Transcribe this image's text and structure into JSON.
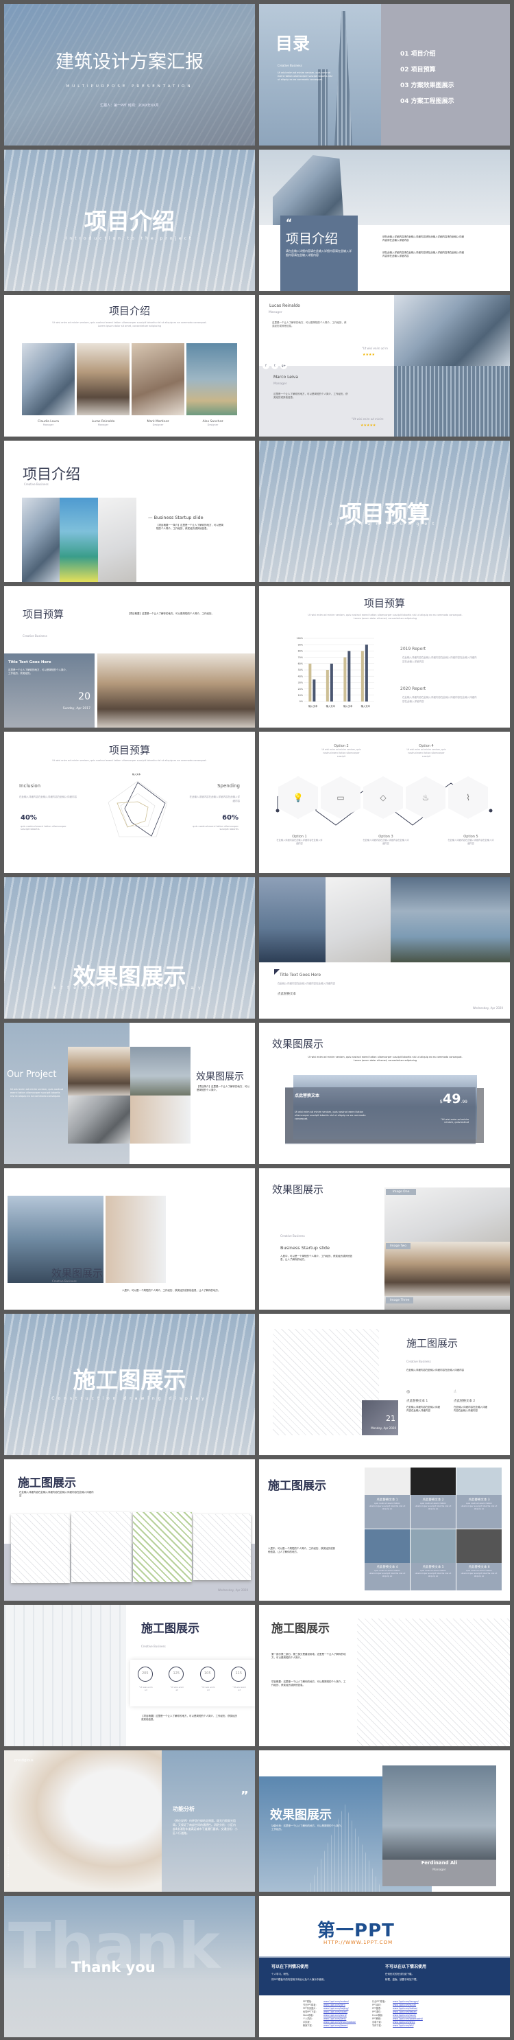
{
  "colors": {
    "background": "#5a5a5a",
    "accent_blue": "#5d7390",
    "navy": "#1e3c6e",
    "tan": "#cdbf95",
    "bar_navy": "#4a5670",
    "logo_orange": "#e07a1f"
  },
  "s1": {
    "title": "建筑设计方案汇报",
    "subtitle": "MULTIPURPOSE PRESENTATION",
    "info": "汇报人：第一PPT   时间：20XX年XX月"
  },
  "s2": {
    "title": "目录",
    "tag": "Creative Business",
    "text": "Ut wisi enim ad minim veniam, quis nostrud exerci tation ullamcorper suscipit lobortis nisl ut aliquip ex ea commodo consequat.",
    "items": [
      "01  项目介绍",
      "02  项目预算",
      "03  方案效果图展示",
      "04  方案工程图展示"
    ]
  },
  "s3": {
    "title": "项目介绍",
    "subtitle": "Introduction to the project"
  },
  "s4": {
    "title": "项目介绍",
    "quote": "“",
    "text": "请在此输入详细内容请在此输入详细内容请在此输入详细内容请在此输入详细内容",
    "p1": "请在此输入详细内容请在此输入详细内容请在此输入详细内容请在此输入详细内容请在此输入详细内容",
    "p2": "请在此输入详细内容请在此输入详细内容请在此输入详细内容请在此输入详细内容请在此输入详细内容"
  },
  "s5": {
    "title": "项目介绍",
    "text": "Ut wisi enim ad minim veniam, quis nostrud exerci tation ullamcorper suscipit lobortis nisl ut aliquip ex ea commodo consequat. Lorem ipsum dolor sit amet, consectetuer adipiscing",
    "people": [
      {
        "name": "Claudia Laura",
        "role": "Manager"
      },
      {
        "name": "Lucas Reinaldo",
        "role": "Manager"
      },
      {
        "name": "Mark Martinez",
        "role": "Designer"
      },
      {
        "name": "Alex Sanchez",
        "role": "Designer"
      }
    ]
  },
  "s6": {
    "p1": {
      "name": "Lucas Reinaldo",
      "role": "Manager",
      "quote": "\"Ut wisi enim ad m",
      "stars": 4
    },
    "p2": {
      "name": "Marco Leiva",
      "role": "Manager",
      "quote": "\"Ut wisi enim ad minim",
      "stars": 5
    },
    "text": "这里是一个让人了解你的地方，可以是简短的个人简介、工作经历、获奖经历或其他信息。",
    "social": [
      "f",
      "t",
      "g+"
    ]
  },
  "s7": {
    "title": "项目介绍",
    "tag": "Creative Business",
    "heading": "Business Startup slide",
    "text": "【项目概要一一简介】这里是一个让人了解你的地方，可以是简短的个人简介、工作经历、获奖经历或其他信息。"
  },
  "s8": {
    "title": "项目预算",
    "subtitle": "program budget"
  },
  "s9": {
    "title": "项目预算",
    "tag": "Creative Business",
    "text": "【项目概要】这里是一个让人了解你的地方，可以是简短的个人简介、工作经历。",
    "box_title": "Title Text Goes Here",
    "box_text": "这里是一个让人了解你的地方，可以是简短的个人简介、工作经历、获奖经历。",
    "day": "20",
    "date": "Sunday, Apr 2017"
  },
  "s10": {
    "title": "项目预算",
    "text": "Ut wisi enim ad minim veniam, quis nostrud exerci tation ullamcorper suscipit lobortis nisl ut aliquip ex ea commodo consequat. Lorem ipsum dolor sit amet, consectetuer adipiscing",
    "r1": "2019 Report",
    "r2": "2020 Report",
    "rtext": "在此输入详细内容在此输入详细内容在此输入详细内容在此输入详细内容在此输入详细内容"
  },
  "chart_data": {
    "type": "bar",
    "categories": [
      "输入文本",
      "输入文本",
      "输入文本",
      "输入文本"
    ],
    "series": [
      {
        "values": [
          6,
          5,
          7,
          8
        ],
        "color": "#cdbf95"
      },
      {
        "values": [
          3.5,
          6,
          8,
          9
        ],
        "color": "#4a5670"
      }
    ],
    "ylim": [
      0,
      10
    ],
    "yticks": [
      "0%",
      "10%",
      "20%",
      "30%",
      "40%",
      "50%",
      "60%",
      "70%",
      "80%",
      "90%",
      "100%"
    ],
    "grid": true
  },
  "s11": {
    "title": "项目预算",
    "text": "Ut wisi enim ad minim veniam, quis nostrud exerci tation ullamcorper suscipit lobortis nisl ut aliquip ex ea commodo consequat.",
    "left": {
      "label": "Inclusion",
      "pct": "40%",
      "text": "在此输入详细内容在此输入详细内容在此输入详细内容",
      "note": "quis nostrud exerci tation ullamcorper suscipit lobortis"
    },
    "right": {
      "label": "Spending",
      "pct": "60%",
      "text": "在此输入详细内容在此输入详细内容在此输入详细内容",
      "note": "quis nostrud exerci tation ullamcorper suscipit lobortis"
    },
    "axis_label": "输入文本"
  },
  "s12": {
    "options": [
      {
        "label": "Option 1",
        "icon": "lightbulb-icon",
        "glyph": "💡"
      },
      {
        "label": "Option 2",
        "icon": "monitor-icon",
        "glyph": "▭"
      },
      {
        "label": "Option 3",
        "icon": "tag-icon",
        "glyph": "◇"
      },
      {
        "label": "Option 4",
        "icon": "flame-icon",
        "glyph": "♨"
      },
      {
        "label": "Option 5",
        "icon": "paperclip-icon",
        "glyph": "⌇"
      }
    ],
    "top_text": "Ut wisi enim ad minim veniam, quis nostrud exerci tation ullamcorper suscipit",
    "bottom_text": "在此输入详细内容在此输入详细内容在此输入详细内容"
  },
  "s13": {
    "title": "效果图展示",
    "subtitle": "Effect diagram display"
  },
  "s14": {
    "heading": "Title Text Goes Here",
    "text": "在此输入详细内容在此输入详细内容在此输入详细内容",
    "link": "点此替换文本",
    "date": "Wednesday, Apr 2020"
  },
  "s15": {
    "heading": "Our Project",
    "text": "Ut wisi enim ad minim veniam, quis nostrud exerci tation ullamcorper suscipit lobortis nisl ut aliquip ex ea commodo consequat.",
    "title": "效果图展示",
    "body": "【项目简介】这里是一个让人了解你的地方，可以是简短的个人简介。"
  },
  "s16": {
    "title": "效果图展示",
    "text": "Ut wisi enim ad minim veniam, quis nostrud exerci tation ullamcorper suscipit lobortis nisl ut aliquip ex ea commodo consequat. Lorem ipsum dolor sit amet, consectetuer adipiscing",
    "box_title": "点此替换文本",
    "box_text": "Ut wisi enim ad minim veniam, quis nostrud exerci tation ullamcorper suscipit lobortis nisl ut aliquip ex ea commodo consequat.",
    "price_cur": "$",
    "price": "49",
    "price_dec": ".99",
    "price_note": "\"Ut wisi enim ad minim veniam, quisnostrud"
  },
  "s17": {
    "title": "效果图展示",
    "tag": "Creative Business",
    "text": "人居中，可以是一个简短的个人简介、工作经历、获奖经历或其他信息，让人了解你的地方。"
  },
  "s18": {
    "title": "效果图展示",
    "tag": "Creative Business",
    "heading": "Business Startup slide",
    "text": "人居中，可以是一个简短的个人简介、工作经历、获奖经历或其他信息，让人了解你的地方。",
    "images": [
      "Image One",
      "Image Two",
      "Image Three"
    ]
  },
  "s19": {
    "title": "施工图展示",
    "subtitle": "Construction drawing display"
  },
  "s20": {
    "title": "施工图展示",
    "tag": "Creative Business",
    "text": "在此输入详细内容在此输入详细内容在此输入详细内容",
    "day": "21",
    "date": "Monday, Apr 2020",
    "f1": "点此替换文本 1",
    "f2": "点此替换文本 2",
    "ftext": "在此输入详细内容在此输入详细内容在此输入详细内容"
  },
  "s21": {
    "title": "施工图展示",
    "text": "在此输入详细内容在此输入详细内容在此输入详细内容在此输入详细内容",
    "date": "Wednesday, Apr 2020"
  },
  "s22": {
    "title": "施工图展示",
    "text": "人居中，可以是一个简短的个人简介、工作经历、获奖经历或其他信息，让人了解你的地方。",
    "captions": [
      "点此替换文本 1",
      "点此替换文本 2",
      "点此替换文本 3",
      "点此替换文本 4",
      "点此替换文本 5",
      "点此替换文本 6"
    ],
    "ctext": "quis nostrud exerci tation ullamcorper suscipit lobortis nisl ut aliquip ex"
  },
  "s23": {
    "title": "施工图展示",
    "tag": "Creative Business",
    "stats": [
      "205",
      "125",
      "105",
      "115"
    ],
    "stat_note": "\"Ut wisi enim ad",
    "text": "【项目概要】这里是一个让人了解你的地方，可以是简短的个人简介、工作经历、获奖经历或其他信息。"
  },
  "s24": {
    "title": "施工图展示",
    "p1": "第一部分第二部分，第三部分是建设用地，这里是一个让人了解你的地方，可以是简短的个人简介。",
    "p2": "项目概要：这里是一个让人了解你的地方，可以是简短的个人简介、工作经历、获奖经历或其他信息。"
  },
  "s25": {
    "brand": "prestigious",
    "vertical": "PRESTIGIOUS 2020",
    "quote": "”",
    "title": "功能分析",
    "text": "（原位说明）何杯居住绿地北侧面，既无日照采光阻碍，又保证了南部空间的通透性。消防分析：小区内部4米消防车道满足城市干道通行要求。交通分析：小区人行道路。"
  },
  "s26": {
    "title": "效果图展示",
    "text": "功能分析：这里是一个让人了解你的地方，可以是简短的个人简介、工作经历。",
    "name": "Ferdinand Ali",
    "role": "Manager"
  },
  "s27": {
    "bg_word": "Thank",
    "title": "Thank you"
  },
  "s28": {
    "logo_cn": "第一",
    "logo_en": "PPT",
    "url": "HTTP://WWW.1PPT.COM",
    "can_title": "可以在下列情况使用",
    "can": [
      "个人学习、研究。",
      "将PPT模板中的内容用于商业以及个人演示中使用。"
    ],
    "cannot_title": "不可以在以下情况使用",
    "cannot": [
      "任何形式的在线付费下载。",
      "转载、盗版、放置于网站下载。"
    ],
    "links_l": [
      [
        "PPT模板：",
        "www.1ppt.com/moban/"
      ],
      [
        "节日PPT模板：",
        "www.1ppt.com/jieri/"
      ],
      [
        "PPT背景图片：",
        "www.1ppt.com/beijing/"
      ],
      [
        "优秀PPT下载：",
        "www.1ppt.com/xiazai/"
      ],
      [
        "Word模板：",
        "www.1ppt.com/word/"
      ],
      [
        "个人简历：",
        "www.1ppt.com/jianli/"
      ],
      [
        "手抄报：",
        "www.1ppt.com/shouchaobao/"
      ],
      [
        "教案下载：",
        "www.1ppt.com/jiaoan/"
      ]
    ],
    "links_r": [
      [
        "行业PPT模板：",
        "www.1ppt.com/hangye/"
      ],
      [
        "PPT素材：",
        "www.1ppt.com/sucai/"
      ],
      [
        "PPT图表：",
        "www.1ppt.com/tubiao/"
      ],
      [
        "PPT课件：",
        "www.1ppt.com/kejian/"
      ],
      [
        "Excel模板：",
        "www.1ppt.com/excel/"
      ],
      [
        "PPT教程：",
        "www.1ppt.com/powerpoint/"
      ],
      [
        "试卷下载：",
        "www.1ppt.com/shiti/"
      ],
      [
        "字体下载：",
        "www.1ppt.com/ziti/"
      ]
    ]
  }
}
